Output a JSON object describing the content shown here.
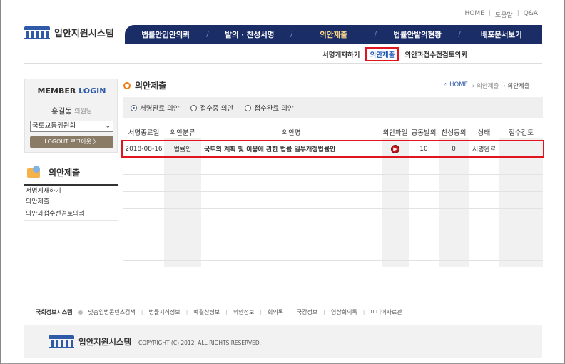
{
  "util_links": [
    "HOME",
    "도움말",
    "Q&A"
  ],
  "logo": {
    "text": "입안지원시스템"
  },
  "gnb": {
    "items": [
      {
        "label": "법률안입안의뢰",
        "active": false
      },
      {
        "label": "발의 · 찬성서명",
        "active": false
      },
      {
        "label": "의안제출",
        "active": true
      },
      {
        "label": "법률안발의현황",
        "active": false
      },
      {
        "label": "배포문서보기",
        "active": false
      }
    ]
  },
  "lnb": {
    "items": [
      {
        "label": "서명게재하기"
      },
      {
        "label": "의안제출"
      },
      {
        "label": "의안과접수전검토의뢰"
      }
    ]
  },
  "login": {
    "title_a": "MEMBER",
    "title_b": "LOGIN",
    "name": "홍길동",
    "name_suffix": "의원님",
    "committee": "국토교통위원회",
    "logout": "LOGOUT 로그아웃  〉"
  },
  "side": {
    "title": "의안제출",
    "items": [
      "서명게재하기",
      "의안제출",
      "의안과접수전검토의뢰"
    ]
  },
  "content": {
    "title": "의안제출",
    "breadcrumb": [
      "HOME",
      "의안제출",
      "의안제출"
    ]
  },
  "filters": [
    {
      "label": "서명완료 의안",
      "checked": true
    },
    {
      "label": "접수중 의안",
      "checked": false
    },
    {
      "label": "접수완료 의안",
      "checked": false
    }
  ],
  "table": {
    "headers": [
      "서명종료일",
      "의안분류",
      "의안명",
      "의안파일",
      "공동발의",
      "찬성동의",
      "상태",
      "접수검토"
    ],
    "rows": [
      {
        "date": "2018-08-16",
        "type": "법률안",
        "name": "국토의 계획 및 이용에 관한 법률 일부개정법률안",
        "file": "pdf-icon",
        "co": "10",
        "support": "0",
        "status": "서명완료",
        "review": ""
      }
    ]
  },
  "footer": {
    "main": "국회정보시스템",
    "links": [
      "맞춤입법콘텐츠검색",
      "법률지식정보",
      "예결산정보",
      "의안정보",
      "회의록",
      "국감정보",
      "영상회의록",
      "미디어자료관"
    ],
    "logo_text": "입안지원시스템",
    "copyright": "COPYRIGHT (C) 2012. ALL RIGHTS RESERVED."
  }
}
